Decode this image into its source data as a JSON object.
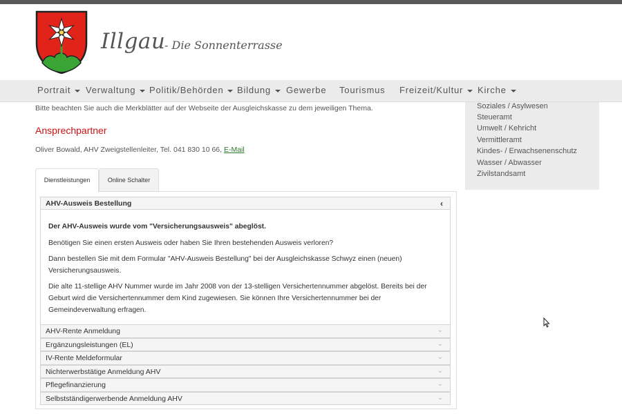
{
  "header": {
    "title": "Illgau",
    "subtitle": "- Die Sonnenterrasse",
    "colors": {
      "crest_red": "#e2231a",
      "crest_green": "#3aa535",
      "title": "#555555"
    }
  },
  "nav": {
    "items": [
      {
        "label": "Portrait",
        "dropdown": true
      },
      {
        "label": "Verwaltung",
        "dropdown": true
      },
      {
        "label": "Politik/Behörden",
        "dropdown": true
      },
      {
        "label": "Bildung",
        "dropdown": true
      },
      {
        "label": "Gewerbe",
        "dropdown": false
      },
      {
        "label": "Tourismus",
        "dropdown": false
      },
      {
        "label": "Freizeit/Kultur",
        "dropdown": true
      },
      {
        "label": "Kirche",
        "dropdown": true
      }
    ]
  },
  "sidebar": {
    "links": [
      "Soziales / Asylwesen",
      "Steueramt",
      "Umwelt / Kehricht",
      "Vermittleramt",
      "Kindes- / Erwachsenenschutz",
      "Wasser / Abwasser",
      "Zivilstandsamt"
    ]
  },
  "main": {
    "intro": "Bitte beachten Sie auch die Merkblätter auf der Webseite der Ausgleichskasse zu dem jeweiligen Thema.",
    "contact_heading": "Ansprechpartner",
    "contact_text": "Oliver Bowald, AHV Zweigstellenleiter, Tel. 041 830 10 66, ",
    "contact_link": "E-Mail",
    "accent_color": "#cc1111",
    "tabs": [
      {
        "label": "Dienstleistungen",
        "active": true
      },
      {
        "label": "Online Schalter",
        "active": false
      }
    ],
    "accordion_open": {
      "title": "AHV-Ausweis Bestellung",
      "chevron": "‹",
      "paragraphs": [
        "Der AHV-Ausweis wurde vom \"Versicherungsausweis\" abeglöst.",
        "Benötigen Sie einen ersten Ausweis oder haben Sie Ihren bestehenden Ausweis verloren?",
        "Dann bestellen Sie mit dem Formular \"AHV-Ausweis Bestellung\" bei der Ausgleichskasse Schwyz einen (neuen) Versicherungsausweis.",
        "Die alte 11-stellige AHV Nummer wurde im Jahr 2008 von der 13-stelligen Versichertennummer abgelöst. Bereits bei der Geburt wird die Versichertennummer dem Kind zugewiesen. Sie können Ihre Versichertennummer bei der Gemeindeverwaltung erfragen."
      ]
    },
    "accordion_items": [
      "AHV-Rente Anmeldung",
      "Ergänzungsleistungen (EL)",
      "IV-Rente Meldeformular",
      "Nichterwerbstätige Anmeldung AHV",
      "Pflegefinanzierung",
      "Selbstständigerwerbende Anmeldung AHV"
    ]
  }
}
